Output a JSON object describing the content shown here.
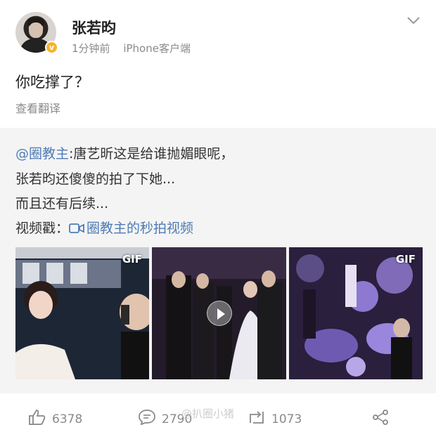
{
  "user": {
    "name": "张若昀",
    "time": "1分钟前",
    "source": "iPhone客户端"
  },
  "post": {
    "text": "你吃撑了？",
    "translate_label": "查看翻译"
  },
  "repost": {
    "mention": "@圈教主",
    "line1_rest": ":唐艺昕这是给谁抛媚眼呢，",
    "line2": "张若昀还傻傻的拍了下她...",
    "line3": "而且还有后续...",
    "video_prefix": "视频戳：",
    "video_link": "圈教主的秒拍视频",
    "thumbnails": [
      {
        "badge": "GIF"
      },
      {
        "badge": ""
      },
      {
        "badge": "GIF"
      }
    ]
  },
  "actions": {
    "likes": "6378",
    "comments": "2790",
    "reposts": "1073"
  },
  "watermark": "@扒圈小猪",
  "colors": {
    "link": "#4f7bb6",
    "verified": "#f6b42b",
    "repost_bg": "#f4f4f4"
  }
}
